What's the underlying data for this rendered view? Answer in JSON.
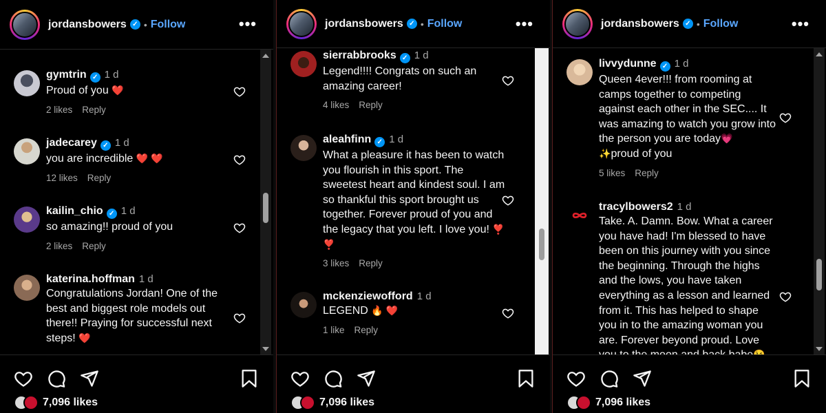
{
  "post": {
    "username": "jordansbowers",
    "follow_label": "Follow",
    "separator": "•",
    "more_label": "•••",
    "likes_count": "7,096 likes"
  },
  "panels": [
    {
      "comments": [
        {
          "user": "gymtrin",
          "verified": true,
          "time": "1 d",
          "text": "Proud of you",
          "emoji": "❤️",
          "likes": "2 likes",
          "reply": "Reply"
        },
        {
          "user": "jadecarey",
          "verified": true,
          "time": "1 d",
          "text": "you are incredible",
          "emoji": "❤️ ❤️",
          "likes": "12 likes",
          "reply": "Reply"
        },
        {
          "user": "kailin_chio",
          "verified": true,
          "time": "1 d",
          "text": "so amazing!! proud of you",
          "emoji": "",
          "likes": "2 likes",
          "reply": "Reply"
        },
        {
          "user": "katerina.hoffman",
          "verified": false,
          "time": "1 d",
          "text": "Congratulations Jordan! One of the best and biggest role models out there!! Praying for successful next steps!",
          "emoji": "❤️",
          "likes": "",
          "reply": ""
        }
      ]
    },
    {
      "comments": [
        {
          "user": "sierrabbrooks",
          "verified": true,
          "time": "1 d",
          "text": "Legend!!!! Congrats on such an amazing career!",
          "emoji": "",
          "likes": "4 likes",
          "reply": "Reply"
        },
        {
          "user": "aleahfinn",
          "verified": true,
          "time": "1 d",
          "text": "What a pleasure it has been to watch you flourish in this sport. The sweetest heart and kindest soul. I am so thankful this sport brought us together. Forever proud of you and the legacy that you left. I love you!",
          "emoji": "❣️ ❣️",
          "likes": "3 likes",
          "reply": "Reply"
        },
        {
          "user": "mckenziewofford",
          "verified": false,
          "time": "1 d",
          "text": "LEGEND",
          "emoji": "🔥 ❤️",
          "likes": "1 like",
          "reply": "Reply"
        }
      ]
    },
    {
      "comments": [
        {
          "user": "livvydunne",
          "verified": true,
          "time": "1 d",
          "text": "Queen 4ever!!! from rooming at camps together to competing against each other in the SEC.... It was amazing to watch you grow into the person you are today",
          "emoji": "💗",
          "text2": "proud of you",
          "emoji2": "✨",
          "likes": "5 likes",
          "reply": "Reply"
        },
        {
          "user": "tracylbowers2",
          "verified": false,
          "time": "1 d",
          "text": "Take. A. Damn. Bow. What a career you have had! I'm blessed to have been on this journey with you since the beginning. Through the highs and the lows, you have taken everything as a lesson and learned from it. This has helped to shape you in to the amazing woman you are. Forever beyond proud. Love you to the moon and back babe",
          "emoji": "😘",
          "likes": "",
          "reply": ""
        }
      ]
    }
  ],
  "colors": {
    "background": "#000000",
    "text": "#f5f5f5",
    "muted": "#a8a8a8",
    "follow": "#5aa7ff",
    "verified": "#0095f6",
    "heart_red": "#ff3040"
  },
  "icons": [
    "heart-icon",
    "comment-icon",
    "share-icon",
    "save-icon",
    "verified-icon",
    "more-icon"
  ]
}
